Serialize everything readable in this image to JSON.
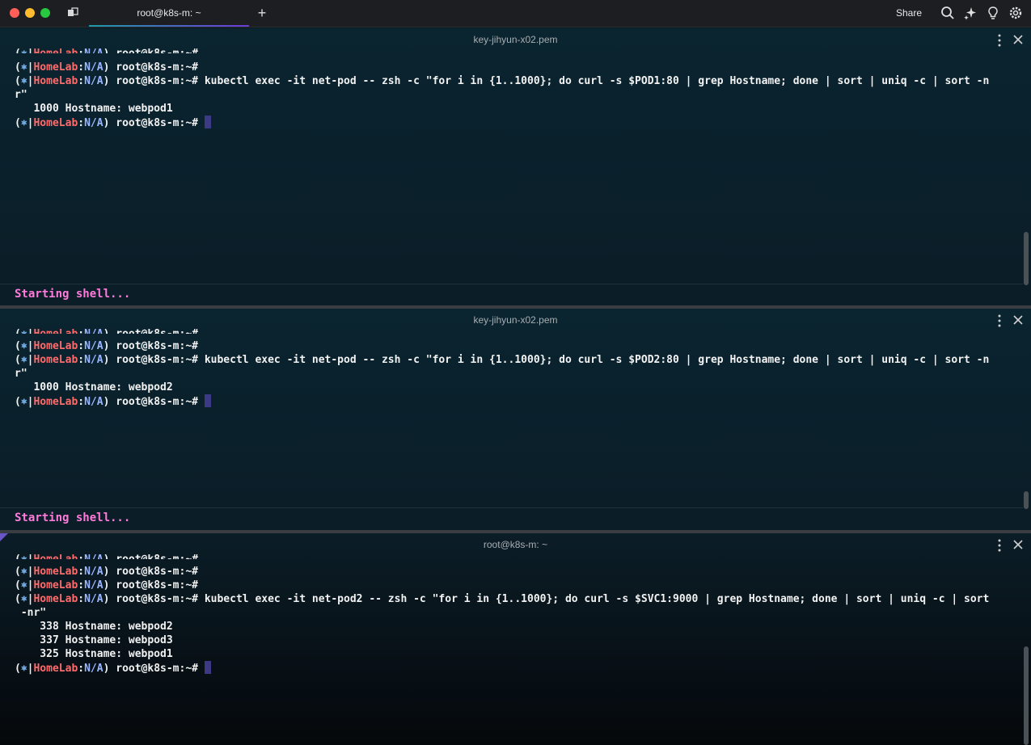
{
  "window": {
    "tab_title": "root@k8s-m: ~",
    "new_tab_symbol": "+",
    "share_label": "Share",
    "icons": [
      "tabs-icon",
      "search-icon",
      "ai-sparkle-icon",
      "lightbulb-icon",
      "settings-icon"
    ]
  },
  "prompt": {
    "open": "(",
    "star": "⎈",
    "sep1": "|",
    "cluster": "HomeLab",
    "colon": ":",
    "ns": "N/A",
    "rest": ") root@k8s-m:~#"
  },
  "panes": [
    {
      "title": "key-jihyun-x02.pem",
      "command": " kubectl exec -it net-pod -- zsh -c \"for i in {1..1000}; do curl -s $POD1:80 | grep Hostname; done | sort | uniq -c | sort -n",
      "wrap": "r\"",
      "output": [
        "   1000 Hostname: webpod1"
      ],
      "status": "Starting shell..."
    },
    {
      "title": "key-jihyun-x02.pem",
      "command": " kubectl exec -it net-pod -- zsh -c \"for i in {1..1000}; do curl -s $POD2:80 | grep Hostname; done | sort | uniq -c | sort -n",
      "wrap": "r\"",
      "output": [
        "   1000 Hostname: webpod2"
      ],
      "status": "Starting shell..."
    },
    {
      "title": "root@k8s-m: ~",
      "command": " kubectl exec -it net-pod2 -- zsh -c \"for i in {1..1000}; do curl -s $SVC1:9000 | grep Hostname; done | sort | uniq -c | sort",
      "wrap": " -nr\"",
      "output": [
        "    338 Hostname: webpod2",
        "    337 Hostname: webpod3",
        "    325 Hostname: webpod1"
      ]
    }
  ],
  "colors": {
    "cluster": "#ff6b6b",
    "namespace": "#9ab6ff",
    "status": "#ff7ad9",
    "cursor": "#3d3a85"
  }
}
